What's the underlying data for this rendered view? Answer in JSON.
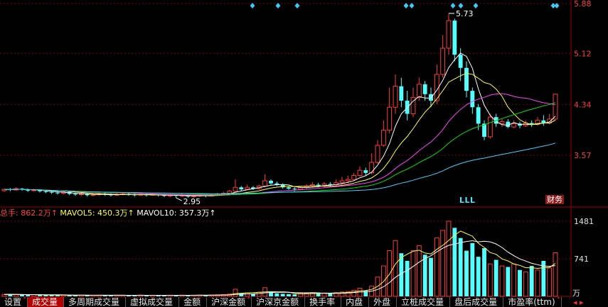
{
  "chart_data": {
    "type": "candlestick",
    "price_axis": {
      "ticks": [
        "5.88",
        "5.12",
        "4.34",
        "3.57"
      ],
      "min": 2.78,
      "max": 5.88
    },
    "annotations": {
      "high_label": "5.73",
      "low_label": "2.95"
    },
    "candles": [
      [
        3.03,
        3.05,
        3.01,
        3.06
      ],
      [
        3.05,
        3.04,
        3.02,
        3.07
      ],
      [
        3.04,
        3.06,
        3.03,
        3.08
      ],
      [
        3.06,
        3.05,
        3.03,
        3.07
      ],
      [
        3.05,
        3.03,
        3.01,
        3.06
      ],
      [
        3.03,
        3.04,
        3.02,
        3.06
      ],
      [
        3.04,
        3.02,
        3.0,
        3.05
      ],
      [
        3.02,
        3.01,
        2.99,
        3.04
      ],
      [
        3.01,
        3.0,
        2.98,
        3.03
      ],
      [
        3.0,
        2.99,
        2.97,
        3.02
      ],
      [
        2.99,
        3.01,
        2.97,
        3.03
      ],
      [
        3.01,
        2.98,
        2.96,
        3.02
      ],
      [
        2.98,
        2.97,
        2.95,
        3.0
      ],
      [
        2.97,
        2.98,
        2.95,
        3.0
      ],
      [
        2.98,
        2.96,
        2.94,
        2.99
      ],
      [
        2.96,
        2.97,
        2.94,
        2.99
      ],
      [
        2.97,
        2.98,
        2.95,
        3.0
      ],
      [
        2.98,
        2.97,
        2.95,
        3.0
      ],
      [
        2.97,
        2.96,
        2.94,
        2.99
      ],
      [
        2.96,
        2.97,
        2.95,
        2.99
      ],
      [
        2.97,
        2.98,
        2.96,
        3.0
      ],
      [
        2.98,
        2.97,
        2.95,
        3.0
      ],
      [
        2.97,
        2.96,
        2.94,
        2.99
      ],
      [
        2.96,
        2.97,
        2.95,
        2.99
      ],
      [
        2.97,
        2.96,
        2.94,
        2.98
      ],
      [
        2.96,
        2.97,
        2.95,
        2.99
      ],
      [
        2.97,
        2.96,
        2.94,
        2.98
      ],
      [
        2.96,
        2.95,
        2.93,
        2.98
      ],
      [
        2.95,
        2.96,
        2.93,
        2.98
      ],
      [
        2.96,
        2.95,
        2.92,
        2.97
      ],
      [
        2.95,
        2.96,
        2.93,
        2.98
      ],
      [
        2.96,
        2.94,
        2.92,
        2.97
      ],
      [
        2.94,
        2.95,
        2.92,
        2.97
      ],
      [
        2.95,
        2.96,
        2.93,
        2.98
      ],
      [
        2.96,
        2.95,
        2.93,
        2.97
      ],
      [
        2.95,
        2.96,
        2.94,
        2.98
      ],
      [
        2.96,
        2.98,
        2.95,
        3.0
      ],
      [
        2.98,
        2.99,
        2.96,
        3.01
      ],
      [
        2.99,
        3.02,
        2.98,
        3.04
      ],
      [
        3.02,
        3.08,
        3.01,
        3.2
      ],
      [
        3.08,
        3.05,
        3.03,
        3.1
      ],
      [
        3.05,
        3.08,
        3.04,
        3.12
      ],
      [
        3.08,
        3.06,
        3.04,
        3.1
      ],
      [
        3.06,
        3.1,
        3.05,
        3.12
      ],
      [
        3.1,
        3.18,
        3.08,
        3.28
      ],
      [
        3.18,
        3.14,
        3.12,
        3.2
      ],
      [
        3.14,
        3.12,
        3.1,
        3.17
      ],
      [
        3.12,
        3.08,
        3.06,
        3.14
      ],
      [
        3.08,
        3.06,
        3.04,
        3.1
      ],
      [
        3.06,
        3.05,
        3.02,
        3.08
      ],
      [
        3.05,
        3.08,
        3.04,
        3.1
      ],
      [
        3.08,
        3.1,
        3.06,
        3.13
      ],
      [
        3.1,
        3.12,
        3.08,
        3.16
      ],
      [
        3.12,
        3.1,
        3.08,
        3.15
      ],
      [
        3.1,
        3.13,
        3.08,
        3.16
      ],
      [
        3.13,
        3.12,
        3.1,
        3.16
      ],
      [
        3.12,
        3.15,
        3.1,
        3.2
      ],
      [
        3.15,
        3.18,
        3.12,
        3.24
      ],
      [
        3.18,
        3.2,
        3.14,
        3.26
      ],
      [
        3.2,
        3.26,
        3.18,
        3.3
      ],
      [
        3.26,
        3.34,
        3.24,
        3.4
      ],
      [
        3.34,
        3.3,
        3.26,
        3.38
      ],
      [
        3.3,
        3.46,
        3.28,
        3.6
      ],
      [
        3.46,
        3.72,
        3.44,
        3.8
      ],
      [
        3.72,
        3.95,
        3.7,
        4.1
      ],
      [
        3.95,
        4.3,
        3.9,
        4.6
      ],
      [
        4.3,
        4.62,
        4.2,
        4.8
      ],
      [
        4.62,
        4.4,
        4.3,
        4.75
      ],
      [
        4.4,
        4.2,
        4.1,
        4.55
      ],
      [
        4.2,
        4.45,
        4.15,
        4.6
      ],
      [
        4.45,
        4.65,
        4.4,
        4.75
      ],
      [
        4.65,
        4.5,
        4.4,
        4.7
      ],
      [
        4.5,
        4.4,
        4.3,
        4.6
      ],
      [
        4.4,
        4.8,
        4.35,
        4.95
      ],
      [
        4.8,
        5.2,
        4.75,
        5.4
      ],
      [
        5.2,
        5.62,
        5.1,
        5.73
      ],
      [
        5.62,
        5.1,
        5.0,
        5.65
      ],
      [
        5.1,
        4.9,
        4.7,
        5.2
      ],
      [
        4.9,
        4.55,
        4.45,
        5.0
      ],
      [
        4.55,
        4.3,
        4.2,
        4.6
      ],
      [
        4.3,
        4.05,
        3.95,
        4.35
      ],
      [
        4.05,
        3.85,
        3.8,
        4.1
      ],
      [
        3.85,
        4.15,
        3.82,
        4.2
      ],
      [
        4.15,
        4.05,
        4.0,
        4.2
      ],
      [
        4.05,
        4.08,
        4.0,
        4.12
      ],
      [
        4.08,
        4.0,
        3.98,
        4.12
      ],
      [
        4.0,
        4.05,
        3.98,
        4.1
      ],
      [
        4.05,
        4.02,
        3.98,
        4.08
      ],
      [
        4.02,
        4.06,
        4.0,
        4.1
      ],
      [
        4.06,
        4.04,
        4.0,
        4.1
      ],
      [
        4.04,
        4.1,
        4.02,
        4.15
      ],
      [
        4.1,
        4.06,
        4.02,
        4.18
      ],
      [
        4.06,
        4.12,
        4.04,
        4.2
      ],
      [
        4.12,
        4.5,
        4.1,
        4.5
      ]
    ],
    "volume": [
      38,
      42,
      35,
      30,
      28,
      33,
      26,
      25,
      24,
      22,
      28,
      21,
      20,
      23,
      19,
      22,
      24,
      21,
      20,
      22,
      23,
      21,
      19,
      24,
      20,
      22,
      21,
      19,
      23,
      20,
      24,
      22,
      21,
      25,
      23,
      26,
      30,
      34,
      45,
      140,
      60,
      70,
      50,
      80,
      170,
      90,
      60,
      50,
      45,
      40,
      55,
      60,
      70,
      62,
      68,
      58,
      75,
      85,
      95,
      120,
      160,
      110,
      200,
      380,
      600,
      900,
      1100,
      850,
      700,
      900,
      1000,
      820,
      760,
      1150,
      1300,
      1481,
      1350,
      1150,
      900,
      1050,
      780,
      950,
      640,
      720,
      600,
      580,
      640,
      520,
      480,
      600,
      520,
      700,
      560,
      860
    ],
    "volume_axis": {
      "ticks": [
        "1481",
        "741"
      ],
      "unit": "万",
      "max": 1481
    },
    "volume_legend": {
      "total": "总手: 862.2万↑",
      "mavol5": "MAVOL5: 450.3万↑",
      "mavol10": "MAVOL10: 357.3万↑"
    },
    "ma_colors": [
      "#ffffff",
      "#ffff40",
      "#ff40ff",
      "#00e000",
      "#40d0ff"
    ],
    "up_color": "#ff3c3c",
    "down_color": "#54ffff"
  },
  "markers": {
    "lll": "LLL",
    "finance": "财务"
  },
  "tabs": [
    {
      "label": "设置",
      "mark": "*"
    },
    {
      "label": "成交量",
      "active": true
    },
    {
      "label": "多周期成交量"
    },
    {
      "label": "虚拟成交量"
    },
    {
      "label": "金额"
    },
    {
      "label": "沪深金额",
      "mark": "*"
    },
    {
      "label": "沪深京金额"
    },
    {
      "label": "换手率"
    },
    {
      "label": "内盘"
    },
    {
      "label": "外盘"
    },
    {
      "label": "立桩成交量"
    },
    {
      "label": "盘后成交量"
    },
    {
      "label": "市盈率(ttm)",
      "mark": "*"
    }
  ],
  "scroll_arrows": "◂ ▸"
}
